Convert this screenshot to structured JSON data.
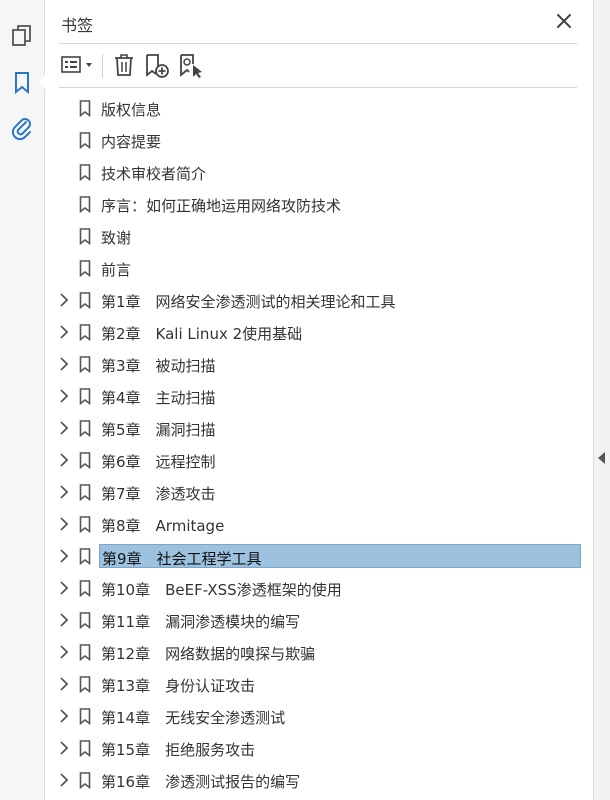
{
  "panel": {
    "title": "书签"
  },
  "left_rail": {
    "icons": [
      "pages-icon",
      "bookmark-icon",
      "attachment-icon"
    ],
    "accent_color": "#2a77c9"
  },
  "toolbar": {
    "buttons": [
      "options-menu-icon",
      "delete-bookmark-icon",
      "new-bookmark-icon",
      "find-current-bookmark-icon"
    ]
  },
  "bookmarks": [
    {
      "label": "版权信息",
      "expandable": false
    },
    {
      "label": "内容提要",
      "expandable": false
    },
    {
      "label": "技术审校者简介",
      "expandable": false
    },
    {
      "label": "序言：如何正确地运用网络攻防技术",
      "expandable": false
    },
    {
      "label": "致谢",
      "expandable": false
    },
    {
      "label": "前言",
      "expandable": false
    },
    {
      "label": "第1章　网络安全渗透测试的相关理论和工具",
      "expandable": true
    },
    {
      "label": "第2章　Kali Linux 2使用基础",
      "expandable": true
    },
    {
      "label": "第3章　被动扫描",
      "expandable": true
    },
    {
      "label": "第4章　主动扫描",
      "expandable": true
    },
    {
      "label": "第5章　漏洞扫描",
      "expandable": true
    },
    {
      "label": "第6章　远程控制",
      "expandable": true
    },
    {
      "label": "第7章　渗透攻击",
      "expandable": true
    },
    {
      "label": "第8章　Armitage",
      "expandable": true
    },
    {
      "label": "第9章　社会工程学工具",
      "expandable": true,
      "selected": true
    },
    {
      "label": "第10章　BeEF-XSS渗透框架的使用",
      "expandable": true
    },
    {
      "label": "第11章　漏洞渗透模块的编写",
      "expandable": true
    },
    {
      "label": "第12章　网络数据的嗅探与欺骗",
      "expandable": true
    },
    {
      "label": "第13章　身份认证攻击",
      "expandable": true
    },
    {
      "label": "第14章　无线安全渗透测试",
      "expandable": true
    },
    {
      "label": "第15章　拒绝服务攻击",
      "expandable": true
    },
    {
      "label": "第16章　渗透测试报告的编写",
      "expandable": true
    }
  ],
  "colors": {
    "selection": "#9cc2e0",
    "icon_gray": "#555555"
  }
}
